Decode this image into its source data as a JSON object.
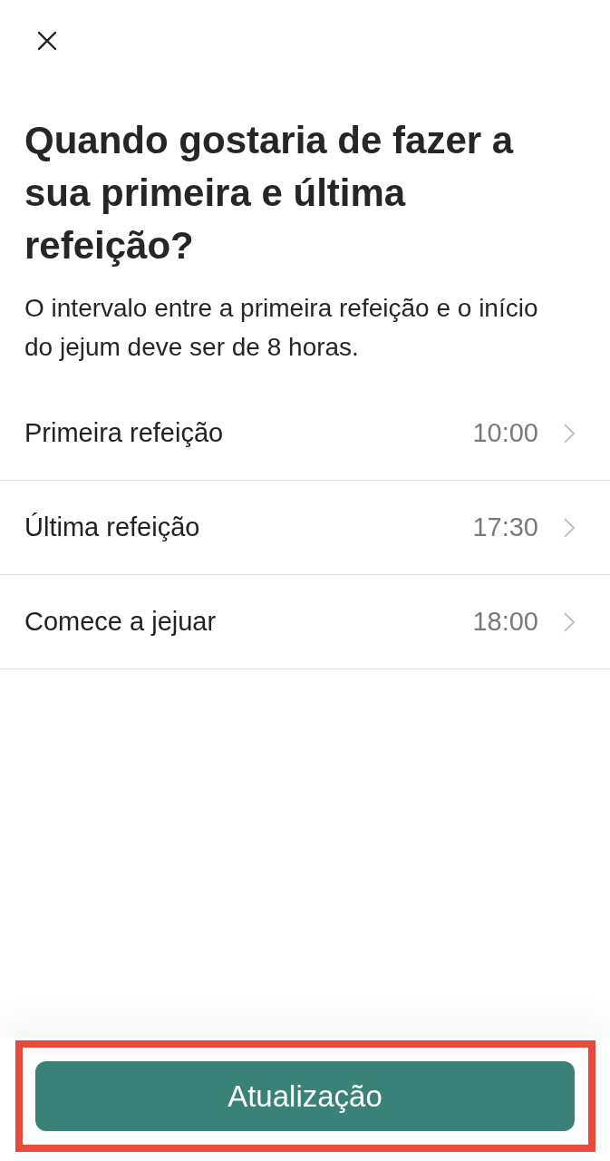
{
  "title": "Quando gostaria de fazer a sua primeira e última refeição?",
  "subtitle": "O intervalo entre a primeira refeição e o início do jejum deve ser de 8 horas.",
  "rows": [
    {
      "label": "Primeira refeição",
      "value": "10:00"
    },
    {
      "label": "Última refeição",
      "value": "17:30"
    },
    {
      "label": "Comece a jejuar",
      "value": "18:00"
    }
  ],
  "button": {
    "label": "Atualização"
  }
}
